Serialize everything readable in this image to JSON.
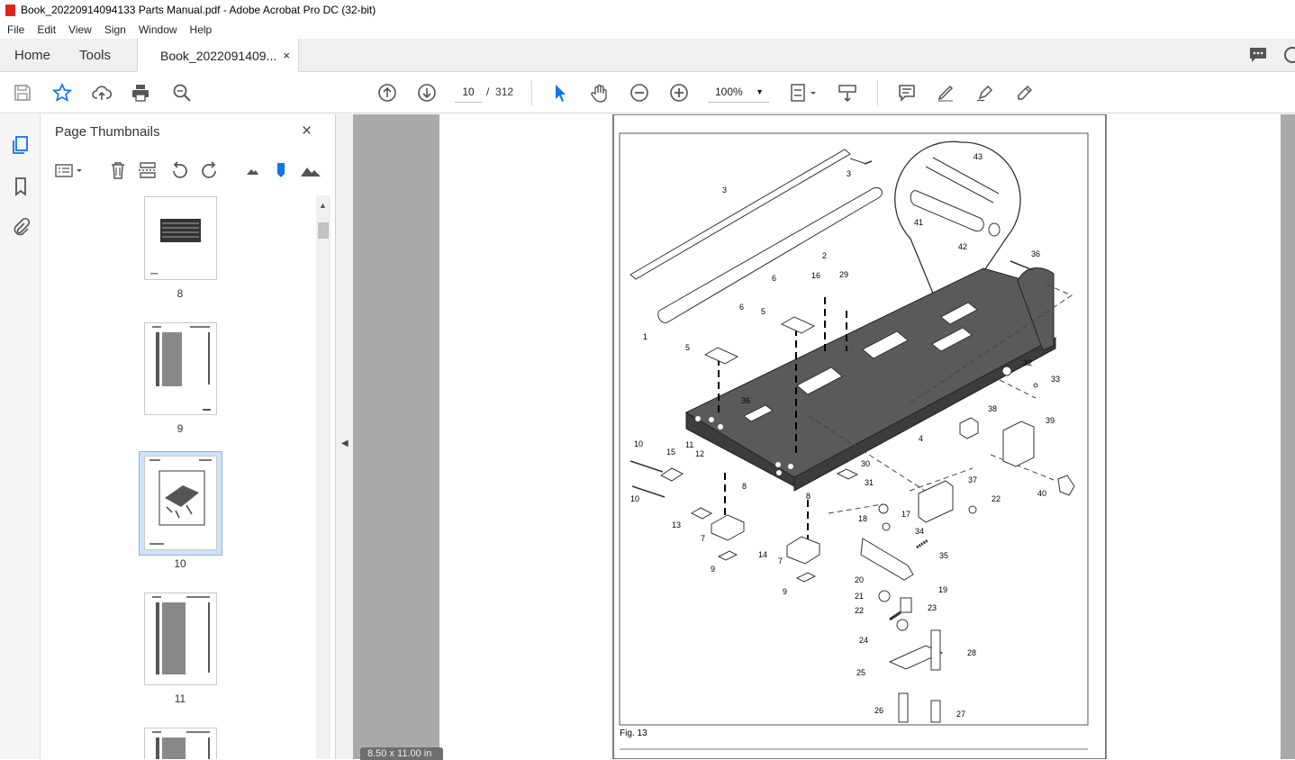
{
  "window": {
    "title": "Book_20220914094133 Parts Manual.pdf - Adobe Acrobat Pro DC (32-bit)"
  },
  "menu": [
    "File",
    "Edit",
    "View",
    "Sign",
    "Window",
    "Help"
  ],
  "tabs": {
    "home": "Home",
    "tools": "Tools",
    "document": "Book_2022091409...",
    "close": "×"
  },
  "toolbar": {
    "page_current": "10",
    "page_sep": "/",
    "page_total": "312",
    "zoom": "100%"
  },
  "panel": {
    "title": "Page Thumbnails",
    "close": "×",
    "thumbnails": [
      {
        "label": "8",
        "selected": false
      },
      {
        "label": "9",
        "selected": false
      },
      {
        "label": "10",
        "selected": true
      },
      {
        "label": "11",
        "selected": false
      }
    ]
  },
  "document": {
    "page_size": "8.50 x 11.00 in",
    "figure_caption": "Fig. 13",
    "callouts": [
      "1",
      "2",
      "3",
      "3",
      "4",
      "5",
      "5",
      "6",
      "6",
      "7",
      "7",
      "8",
      "8",
      "9",
      "9",
      "10",
      "10",
      "11",
      "12",
      "13",
      "14",
      "15",
      "16",
      "17",
      "18",
      "19",
      "20",
      "21",
      "22",
      "22",
      "23",
      "24",
      "25",
      "26",
      "27",
      "28",
      "29",
      "30",
      "31",
      "32",
      "33",
      "34",
      "35",
      "36",
      "36",
      "37",
      "38",
      "39",
      "40",
      "41",
      "42",
      "43"
    ]
  },
  "colors": {
    "accent_blue": "#1473e6",
    "selected_thumb_bg": "#cfe3f7",
    "part_fill": "#5a5a5a"
  }
}
